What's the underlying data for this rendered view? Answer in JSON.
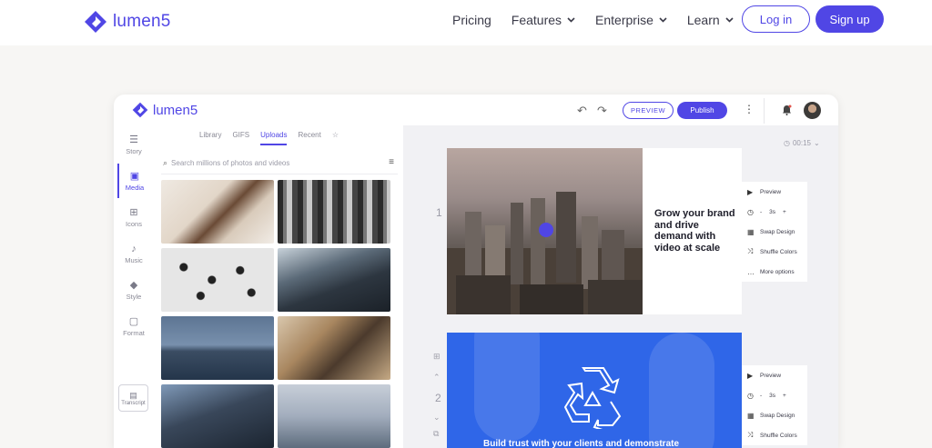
{
  "site": {
    "brand": "lumen5",
    "nav": [
      {
        "label": "Pricing",
        "dropdown": false
      },
      {
        "label": "Features",
        "dropdown": true
      },
      {
        "label": "Enterprise",
        "dropdown": true
      },
      {
        "label": "Learn",
        "dropdown": true
      }
    ],
    "login_label": "Log in",
    "signup_label": "Sign up",
    "accent": "#5046e5"
  },
  "app": {
    "brand": "lumen5",
    "preview_label": "PREVIEW",
    "publish_label": "Publish",
    "sidebar": [
      {
        "label": "Story",
        "icon": "story-icon"
      },
      {
        "label": "Media",
        "icon": "media-icon",
        "active": true
      },
      {
        "label": "Icons",
        "icon": "icons-icon"
      },
      {
        "label": "Music",
        "icon": "music-icon"
      },
      {
        "label": "Style",
        "icon": "style-icon"
      },
      {
        "label": "Format",
        "icon": "format-icon"
      }
    ],
    "transcript_label": "Transcript",
    "media_tabs": [
      "Library",
      "GIFS",
      "Uploads",
      "Recent"
    ],
    "active_tab": "Uploads",
    "search_placeholder": "Search millions of photos and videos",
    "duration": "00:15",
    "scenes": [
      {
        "number": "1",
        "text": "Grow your brand and drive demand with video at scale"
      },
      {
        "number": "2",
        "text": "Build trust with your clients and demonstrate"
      }
    ],
    "scene_options": {
      "preview": "Preview",
      "minus": "-",
      "seconds": "3s",
      "plus": "+",
      "swap_design": "Swap Design",
      "shuffle_colors": "Shuffle Colors",
      "more_options": "More options"
    }
  }
}
